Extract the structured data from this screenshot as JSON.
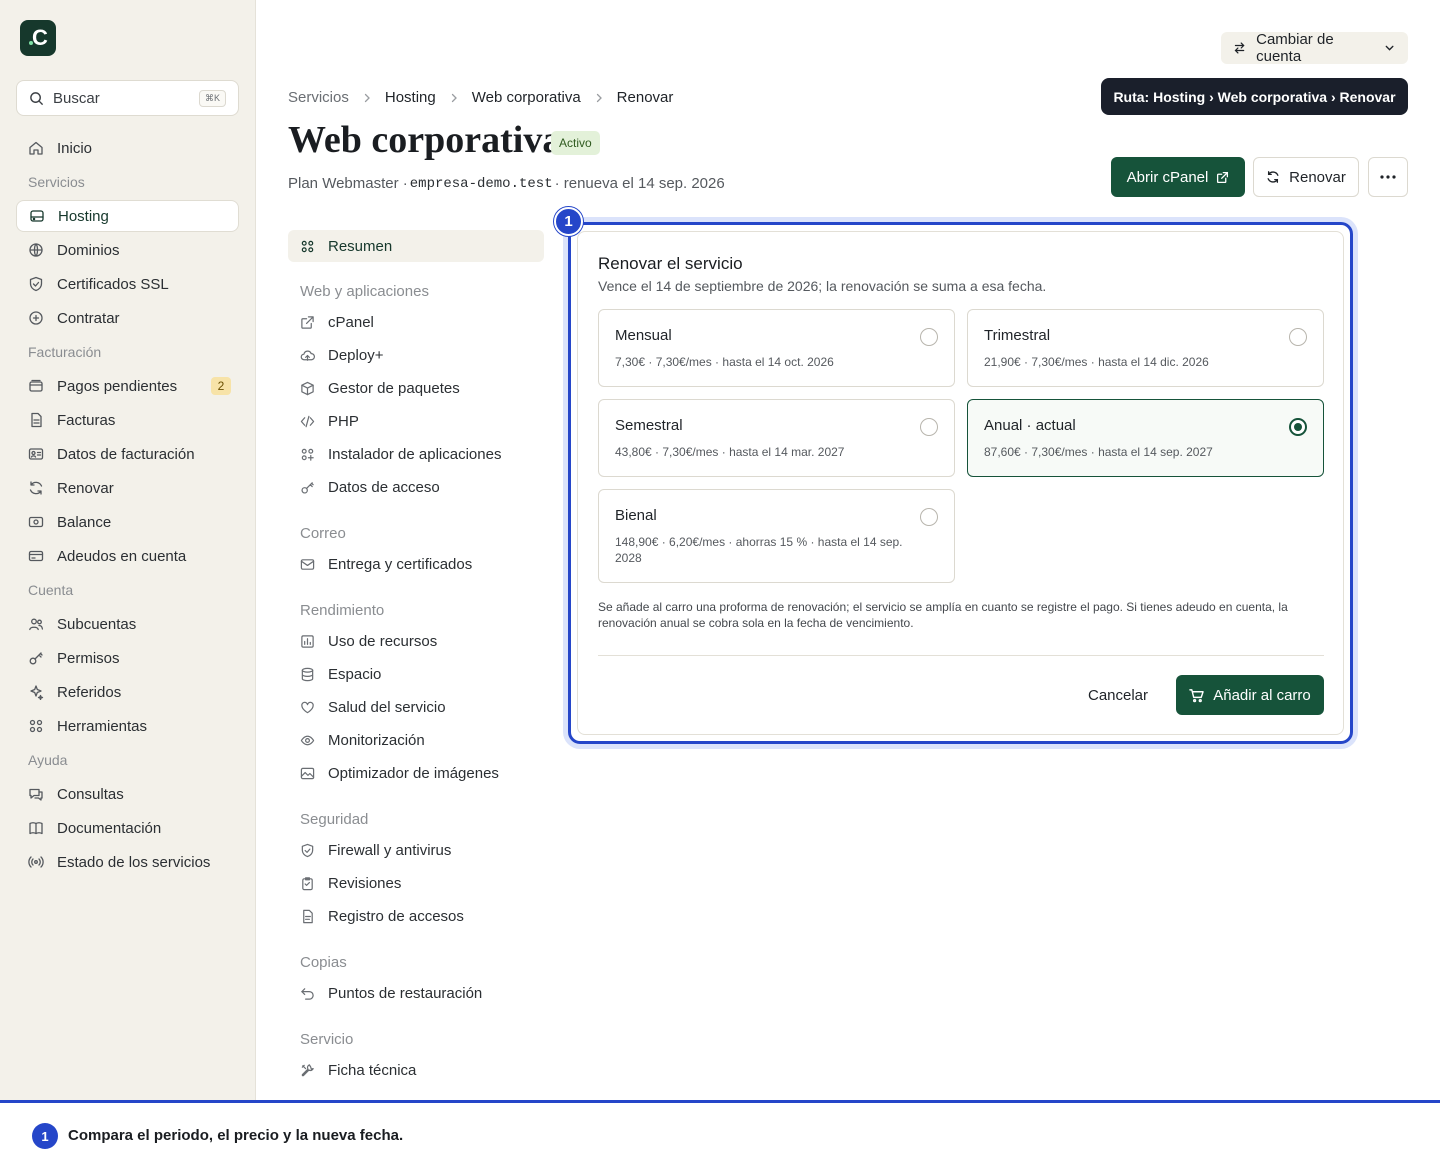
{
  "sidebar": {
    "search": {
      "placeholder": "Buscar",
      "shortcut": "⌘K"
    },
    "items": [
      {
        "kind": "item",
        "label": "Inicio",
        "icon": "home-icon"
      },
      {
        "kind": "section",
        "label": "Servicios"
      },
      {
        "kind": "item",
        "label": "Hosting",
        "icon": "server-icon",
        "active": true
      },
      {
        "kind": "item",
        "label": "Dominios",
        "icon": "globe-icon"
      },
      {
        "kind": "item",
        "label": "Certificados SSL",
        "icon": "shield-icon"
      },
      {
        "kind": "item",
        "label": "Contratar",
        "icon": "plus-circle-icon"
      },
      {
        "kind": "section",
        "label": "Facturación"
      },
      {
        "kind": "item",
        "label": "Pagos pendientes",
        "icon": "wallet-icon",
        "badge": "2"
      },
      {
        "kind": "item",
        "label": "Facturas",
        "icon": "invoice-icon"
      },
      {
        "kind": "item",
        "label": "Datos de facturación",
        "icon": "id-card-icon"
      },
      {
        "kind": "item",
        "label": "Renovar",
        "icon": "refresh-icon"
      },
      {
        "kind": "item",
        "label": "Balance",
        "icon": "banknote-icon"
      },
      {
        "kind": "item",
        "label": "Adeudos en cuenta",
        "icon": "credit-card-icon"
      },
      {
        "kind": "section",
        "label": "Cuenta"
      },
      {
        "kind": "item",
        "label": "Subcuentas",
        "icon": "users-icon"
      },
      {
        "kind": "item",
        "label": "Permisos",
        "icon": "key-icon"
      },
      {
        "kind": "item",
        "label": "Referidos",
        "icon": "sparkles-icon"
      },
      {
        "kind": "item",
        "label": "Herramientas",
        "icon": "grid-icon"
      },
      {
        "kind": "section",
        "label": "Ayuda"
      },
      {
        "kind": "item",
        "label": "Consultas",
        "icon": "chat-icon"
      },
      {
        "kind": "item",
        "label": "Documentación",
        "icon": "book-icon"
      },
      {
        "kind": "item",
        "label": "Estado de los servicios",
        "icon": "broadcast-icon"
      }
    ]
  },
  "header": {
    "account_switch": "Cambiar de cuenta",
    "breadcrumb": [
      "Servicios",
      "Hosting",
      "Web corporativa",
      "Renovar"
    ],
    "tooltip": "Ruta: Hosting › Web corporativa › Renovar",
    "title": "Web corporativa",
    "status": "Activo",
    "plan_prefix": "Plan Webmaster ·",
    "domain": "empresa-demo.test",
    "renew_suffix": "· renueva el 14 sep. 2026",
    "open_cpanel": "Abrir cPanel",
    "renew": "Renovar"
  },
  "subnav": [
    {
      "kind": "item",
      "label": "Resumen",
      "icon": "grid-icon",
      "active": true
    },
    {
      "kind": "section",
      "label": "Web y aplicaciones"
    },
    {
      "kind": "item",
      "label": "cPanel",
      "icon": "external-link-icon"
    },
    {
      "kind": "item",
      "label": "Deploy+",
      "icon": "cloud-upload-icon"
    },
    {
      "kind": "item",
      "label": "Gestor de paquetes",
      "icon": "package-icon"
    },
    {
      "kind": "item",
      "label": "PHP",
      "icon": "code-icon"
    },
    {
      "kind": "item",
      "label": "Instalador de aplicaciones",
      "icon": "apps-icon"
    },
    {
      "kind": "item",
      "label": "Datos de acceso",
      "icon": "key-icon"
    },
    {
      "kind": "section",
      "label": "Correo"
    },
    {
      "kind": "item",
      "label": "Entrega y certificados",
      "icon": "mail-icon"
    },
    {
      "kind": "section",
      "label": "Rendimiento"
    },
    {
      "kind": "item",
      "label": "Uso de recursos",
      "icon": "chart-icon"
    },
    {
      "kind": "item",
      "label": "Espacio",
      "icon": "database-icon"
    },
    {
      "kind": "item",
      "label": "Salud del servicio",
      "icon": "heart-icon"
    },
    {
      "kind": "item",
      "label": "Monitorización",
      "icon": "eye-icon"
    },
    {
      "kind": "item",
      "label": "Optimizador de imágenes",
      "icon": "image-icon"
    },
    {
      "kind": "section",
      "label": "Seguridad"
    },
    {
      "kind": "item",
      "label": "Firewall y antivirus",
      "icon": "shield-icon"
    },
    {
      "kind": "item",
      "label": "Revisiones",
      "icon": "clipboard-icon"
    },
    {
      "kind": "item",
      "label": "Registro de accesos",
      "icon": "file-icon"
    },
    {
      "kind": "section",
      "label": "Copias"
    },
    {
      "kind": "item",
      "label": "Puntos de restauración",
      "icon": "undo-icon"
    },
    {
      "kind": "section",
      "label": "Servicio"
    },
    {
      "kind": "item",
      "label": "Ficha técnica",
      "icon": "tools-icon"
    }
  ],
  "dialog": {
    "step": "1",
    "title": "Renovar el servicio",
    "description": "Vence el 14 de septiembre de 2026; la renovación se suma a esa fecha.",
    "options": [
      {
        "name": "Mensual",
        "detail": "7,30€ · 7,30€/mes · hasta el 14 oct. 2026",
        "selected": false
      },
      {
        "name": "Trimestral",
        "detail": "21,90€ · 7,30€/mes · hasta el 14 dic. 2026",
        "selected": false
      },
      {
        "name": "Semestral",
        "detail": "43,80€ · 7,30€/mes · hasta el 14 mar. 2027",
        "selected": false
      },
      {
        "name": "Anual · actual",
        "detail": "87,60€ · 7,30€/mes · hasta el 14 sep. 2027",
        "selected": true
      },
      {
        "name": "Bienal",
        "detail": "148,90€ · 6,20€/mes · ahorras 15 % · hasta el 14 sep. 2028",
        "selected": false
      }
    ],
    "note": "Se añade al carro una proforma de renovación; el servicio se amplía en cuanto se registre el pago. Si tienes adeudo en cuenta, la renovación anual se cobra sola en la fecha de vencimiento.",
    "cancel": "Cancelar",
    "add_to_cart": "Añadir al carro"
  },
  "footer": {
    "step": "1",
    "hint": "Compara el periodo, el precio y la nueva fecha."
  },
  "colors": {
    "brand": "#16533a",
    "highlight": "#2546c9",
    "sidebar_bg": "#f3f1ea"
  }
}
